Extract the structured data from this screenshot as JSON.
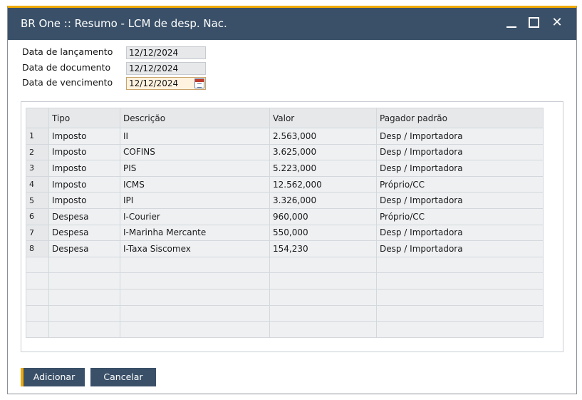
{
  "window": {
    "title": "BR One :: Resumo - LCM de desp. Nac.",
    "minimize_icon": "minimize-icon",
    "maximize_icon": "maximize-icon",
    "close_icon": "close-icon",
    "close_glyph": "✕"
  },
  "form": {
    "posting_date": {
      "label": "Data de lançamento",
      "value": "12/12/2024"
    },
    "document_date": {
      "label": "Data de documento",
      "value": "12/12/2024"
    },
    "due_date": {
      "label": "Data de vencimento",
      "value": "12/12/2024",
      "icon": "calendar-icon"
    }
  },
  "table": {
    "headers": {
      "num": "",
      "tipo": "Tipo",
      "descricao": "Descrição",
      "valor": "Valor",
      "pagador": "Pagador padrão"
    },
    "rows": [
      {
        "num": "1",
        "tipo": "Imposto",
        "descricao": "II",
        "valor": "2.563,000",
        "pagador": "Desp / Importadora"
      },
      {
        "num": "2",
        "tipo": "Imposto",
        "descricao": "COFINS",
        "valor": "3.625,000",
        "pagador": "Desp / Importadora"
      },
      {
        "num": "3",
        "tipo": "Imposto",
        "descricao": "PIS",
        "valor": "5.223,000",
        "pagador": "Desp / Importadora"
      },
      {
        "num": "4",
        "tipo": "Imposto",
        "descricao": "ICMS",
        "valor": "12.562,000",
        "pagador": "Próprio/CC"
      },
      {
        "num": "5",
        "tipo": "Imposto",
        "descricao": "IPI",
        "valor": "3.326,000",
        "pagador": "Desp / Importadora"
      },
      {
        "num": "6",
        "tipo": "Despesa",
        "descricao": "I-Courier",
        "valor": "960,000",
        "pagador": "Próprio/CC"
      },
      {
        "num": "7",
        "tipo": "Despesa",
        "descricao": "I-Marinha Mercante",
        "valor": "550,000",
        "pagador": "Desp / Importadora"
      },
      {
        "num": "8",
        "tipo": "Despesa",
        "descricao": "I-Taxa Siscomex",
        "valor": "154,230",
        "pagador": "Desp / Importadora"
      }
    ]
  },
  "buttons": {
    "add": "Adicionar",
    "cancel": "Cancelar"
  },
  "colors": {
    "titlebar": "#3a5068",
    "accent": "#f0ab00",
    "button": "#3a5068"
  }
}
